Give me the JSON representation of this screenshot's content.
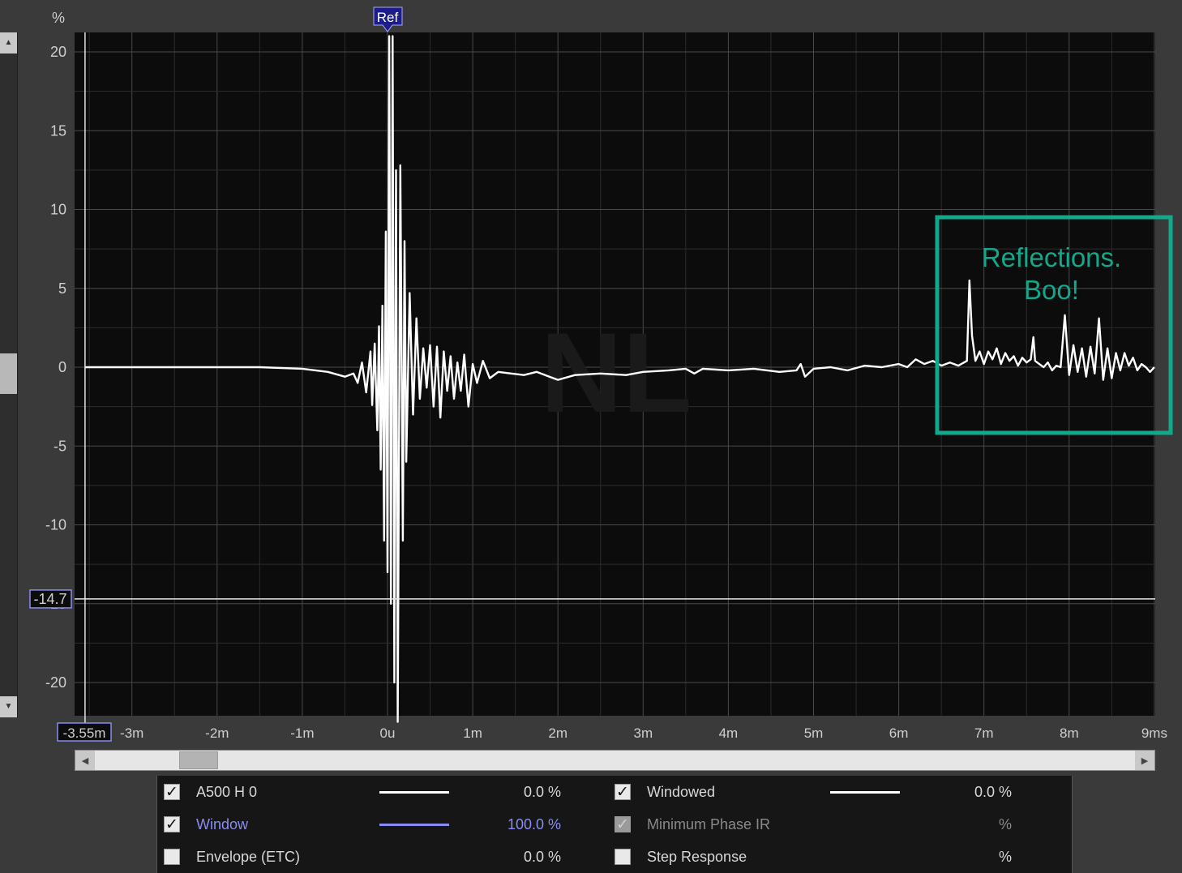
{
  "y_axis": {
    "unit": "%",
    "ticks": [
      "20",
      "15",
      "10",
      "5",
      "0",
      "-5",
      "-10",
      "-15",
      "-20"
    ],
    "cursor_readout": "-14.7"
  },
  "x_axis": {
    "ticks": [
      "-3m",
      "-2m",
      "-1m",
      "0u",
      "1m",
      "2m",
      "3m",
      "4m",
      "5m",
      "6m",
      "7m",
      "8m",
      "9ms"
    ],
    "cursor_readout": "-3.55m"
  },
  "ref_marker": "Ref",
  "watermark": "NL",
  "annotation": {
    "line1": "Reflections.",
    "line2": "Boo!",
    "color": "#12a88b"
  },
  "legend": {
    "left": [
      {
        "label": "A500 H 0",
        "checked": true,
        "swatch_color": "#ffffff",
        "value": "0.0 %",
        "label_color": "#d8d8d8"
      },
      {
        "label": "Window",
        "checked": true,
        "swatch_color": "#8a8cf0",
        "value": "100.0 %",
        "label_color": "#8a8cf0"
      },
      {
        "label": "Envelope (ETC)",
        "checked": false,
        "swatch_color": "",
        "value": "0.0 %",
        "label_color": "#d8d8d8"
      }
    ],
    "right": [
      {
        "label": "Windowed",
        "checked": true,
        "swatch_color": "#ffffff",
        "value": "0.0 %",
        "label_color": "#d8d8d8"
      },
      {
        "label": "Minimum Phase IR",
        "checked": true,
        "disabled": true,
        "swatch_color": "",
        "value": "%",
        "label_color": "#8a8a8a"
      },
      {
        "label": "Step Response",
        "checked": false,
        "swatch_color": "",
        "value": "%",
        "label_color": "#d8d8d8"
      }
    ]
  },
  "chart_data": {
    "type": "line",
    "x_unit": "ms",
    "y_unit": "%",
    "xlim": [
      -3.55,
      9
    ],
    "ylim": [
      -22.5,
      21
    ],
    "grid": true,
    "cursor": {
      "x": -3.55,
      "y": -14.7
    },
    "series": [
      {
        "color": "#ffffff",
        "points": [
          [
            -3.55,
            0
          ],
          [
            -2.5,
            0
          ],
          [
            -1.5,
            0
          ],
          [
            -1.0,
            -0.1
          ],
          [
            -0.7,
            -0.3
          ],
          [
            -0.5,
            -0.6
          ],
          [
            -0.4,
            -0.4
          ],
          [
            -0.35,
            -1.0
          ],
          [
            -0.3,
            0.3
          ],
          [
            -0.25,
            -1.6
          ],
          [
            -0.2,
            1.0
          ],
          [
            -0.18,
            -2.4
          ],
          [
            -0.15,
            1.5
          ],
          [
            -0.12,
            -4.0
          ],
          [
            -0.1,
            2.6
          ],
          [
            -0.08,
            -6.5
          ],
          [
            -0.06,
            3.9
          ],
          [
            -0.04,
            -11.0
          ],
          [
            -0.02,
            8.6
          ],
          [
            0.0,
            -13.0
          ],
          [
            0.02,
            21.0
          ],
          [
            0.04,
            -15.0
          ],
          [
            0.06,
            21.0
          ],
          [
            0.08,
            -20.0
          ],
          [
            0.1,
            12.5
          ],
          [
            0.12,
            -22.5
          ],
          [
            0.15,
            12.8
          ],
          [
            0.18,
            -11.0
          ],
          [
            0.2,
            8.0
          ],
          [
            0.22,
            -6.0
          ],
          [
            0.26,
            4.7
          ],
          [
            0.3,
            -3.0
          ],
          [
            0.34,
            3.1
          ],
          [
            0.38,
            -2.0
          ],
          [
            0.42,
            1.2
          ],
          [
            0.46,
            -1.3
          ],
          [
            0.5,
            1.4
          ],
          [
            0.54,
            -2.5
          ],
          [
            0.58,
            1.3
          ],
          [
            0.62,
            -3.2
          ],
          [
            0.66,
            1.0
          ],
          [
            0.7,
            -1.5
          ],
          [
            0.74,
            0.7
          ],
          [
            0.78,
            -2.0
          ],
          [
            0.82,
            0.3
          ],
          [
            0.86,
            -1.5
          ],
          [
            0.9,
            0.8
          ],
          [
            0.95,
            -2.5
          ],
          [
            1.0,
            0.2
          ],
          [
            1.05,
            -1.0
          ],
          [
            1.12,
            0.4
          ],
          [
            1.2,
            -0.7
          ],
          [
            1.3,
            -0.3
          ],
          [
            1.45,
            -0.4
          ],
          [
            1.6,
            -0.5
          ],
          [
            1.75,
            -0.3
          ],
          [
            1.9,
            -0.6
          ],
          [
            2.0,
            -0.8
          ],
          [
            2.2,
            -0.5
          ],
          [
            2.5,
            -0.4
          ],
          [
            2.8,
            -0.5
          ],
          [
            3.0,
            -0.3
          ],
          [
            3.3,
            -0.2
          ],
          [
            3.5,
            -0.1
          ],
          [
            3.6,
            -0.4
          ],
          [
            3.7,
            -0.1
          ],
          [
            4.0,
            -0.2
          ],
          [
            4.3,
            -0.1
          ],
          [
            4.6,
            -0.3
          ],
          [
            4.8,
            -0.2
          ],
          [
            4.85,
            0.2
          ],
          [
            4.9,
            -0.6
          ],
          [
            5.0,
            -0.1
          ],
          [
            5.2,
            0.0
          ],
          [
            5.4,
            -0.2
          ],
          [
            5.6,
            0.1
          ],
          [
            5.8,
            0.0
          ],
          [
            6.0,
            0.2
          ],
          [
            6.1,
            0.0
          ],
          [
            6.2,
            0.5
          ],
          [
            6.3,
            0.2
          ],
          [
            6.4,
            0.4
          ],
          [
            6.5,
            0.1
          ],
          [
            6.6,
            0.3
          ],
          [
            6.7,
            0.1
          ],
          [
            6.8,
            0.4
          ],
          [
            6.83,
            5.5
          ],
          [
            6.86,
            2.0
          ],
          [
            6.9,
            0.4
          ],
          [
            6.95,
            1.0
          ],
          [
            7.0,
            0.2
          ],
          [
            7.05,
            1.0
          ],
          [
            7.1,
            0.5
          ],
          [
            7.15,
            1.2
          ],
          [
            7.2,
            0.2
          ],
          [
            7.25,
            0.9
          ],
          [
            7.3,
            0.4
          ],
          [
            7.35,
            0.7
          ],
          [
            7.4,
            0.1
          ],
          [
            7.45,
            0.6
          ],
          [
            7.5,
            0.3
          ],
          [
            7.55,
            0.5
          ],
          [
            7.58,
            1.9
          ],
          [
            7.6,
            0.4
          ],
          [
            7.65,
            0.2
          ],
          [
            7.7,
            0.0
          ],
          [
            7.75,
            0.3
          ],
          [
            7.8,
            -0.2
          ],
          [
            7.85,
            0.1
          ],
          [
            7.9,
            0.0
          ],
          [
            7.95,
            3.3
          ],
          [
            8.0,
            -0.5
          ],
          [
            8.05,
            1.4
          ],
          [
            8.1,
            -0.3
          ],
          [
            8.15,
            1.2
          ],
          [
            8.2,
            -0.6
          ],
          [
            8.25,
            1.3
          ],
          [
            8.3,
            -0.4
          ],
          [
            8.35,
            3.1
          ],
          [
            8.4,
            -0.8
          ],
          [
            8.45,
            1.2
          ],
          [
            8.5,
            -0.7
          ],
          [
            8.55,
            0.9
          ],
          [
            8.6,
            -0.2
          ],
          [
            8.65,
            0.9
          ],
          [
            8.7,
            0.1
          ],
          [
            8.75,
            0.6
          ],
          [
            8.8,
            -0.2
          ],
          [
            8.85,
            0.2
          ],
          [
            8.9,
            0.0
          ],
          [
            8.95,
            -0.3
          ],
          [
            9.0,
            0.0
          ]
        ]
      }
    ]
  }
}
